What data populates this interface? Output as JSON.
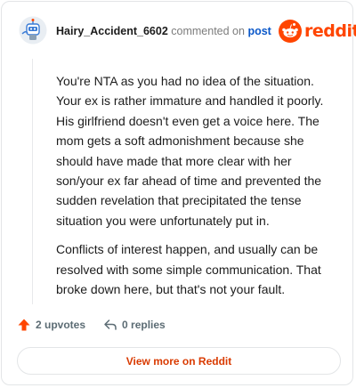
{
  "comment": {
    "username": "Hairy_Accident_6602",
    "action_text": "commented on",
    "post_link_label": "post",
    "paragraphs": [
      "You're NTA as you had no idea of the situation. Your ex is rather immature and handled it poorly. His girlfriend doesn't even get a voice here. The mom gets a soft admonishment because she should have made that more clear with her son/your ex far ahead of time and prevented the sudden revelation that precipitated the tense situation you were unfortunately put in.",
      "Conflicts of interest happen, and usually can be resolved with some simple communication. That broke down here, but that's not your fault."
    ]
  },
  "brand": {
    "wordmark": "reddit",
    "color": "#ff4500"
  },
  "stats": {
    "upvotes_label": "2 upvotes",
    "replies_label": "0 replies"
  },
  "footer": {
    "view_more_label": "View more on Reddit"
  },
  "icons": {
    "avatar": "robot-avatar-icon",
    "brand": "reddit-snoo-icon",
    "upvote": "upvote-arrow-icon",
    "reply": "reply-arrow-icon"
  },
  "colors": {
    "link": "#0b58c9",
    "accent": "#d93a00",
    "muted": "#7c7c7c"
  }
}
